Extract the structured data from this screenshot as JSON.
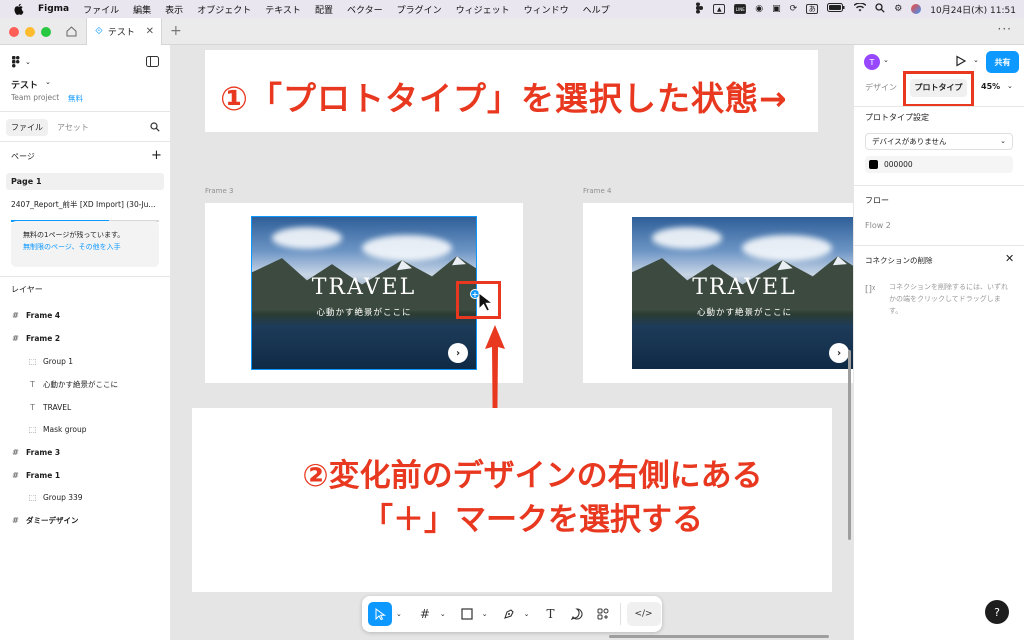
{
  "menubar": {
    "app": "Figma",
    "items": [
      "ファイル",
      "編集",
      "表示",
      "オブジェクト",
      "テキスト",
      "配置",
      "ベクター",
      "プラグイン",
      "ウィジェット",
      "ウィンドウ",
      "ヘルプ"
    ],
    "input_mode": "あ",
    "clock": "10月24日(木)  11:51"
  },
  "window": {
    "tab_title": "テスト",
    "more": "···"
  },
  "left_panel": {
    "file_name": "テスト",
    "team": "Team project",
    "plan": "無料",
    "tabs": [
      "ファイル",
      "アセット"
    ],
    "pages_header": "ページ",
    "pages": [
      "Page 1",
      "2407_Report_前半  [XD Import] (30-Ju..."
    ],
    "upgrade_line1": "無料の1ページが残っています。",
    "upgrade_link": "無制限のページ、その他を入手",
    "upgrade_progress": 0.66,
    "layers_header": "レイヤー",
    "layers": [
      {
        "name": "Frame 4",
        "bold": true,
        "icon": "frame-icon"
      },
      {
        "name": "Frame 2",
        "bold": true,
        "icon": "frame-icon"
      },
      {
        "name": "Group 1",
        "bold": false,
        "icon": "group-icon"
      },
      {
        "name": "心動かす絶景がここに",
        "bold": false,
        "icon": "text-icon"
      },
      {
        "name": "TRAVEL",
        "bold": false,
        "icon": "text-icon"
      },
      {
        "name": "Mask group",
        "bold": false,
        "icon": "group-icon"
      },
      {
        "name": "Frame 3",
        "bold": true,
        "icon": "frame-icon"
      },
      {
        "name": "Frame 1",
        "bold": true,
        "icon": "frame-icon"
      },
      {
        "name": "Group 339",
        "bold": false,
        "icon": "group-icon"
      },
      {
        "name": "ダミーデザイン",
        "bold": true,
        "icon": "frame-icon"
      }
    ]
  },
  "canvas": {
    "frame3_label": "Frame 3",
    "frame4_label": "Frame 4",
    "card_title": "TRAVEL",
    "card_subtitle": "心動かす絶景がここに",
    "callout1": "①「プロトタイプ」を選択した状態→",
    "callout2_line1": "②変化前のデザインの右側にある",
    "callout2_line2": "「＋」マークを選択する",
    "accent_color": "#e8381f",
    "selection_color": "#0d99ff"
  },
  "toolbar": {
    "tools": [
      "move-tool",
      "frame-tool",
      "shape-tool",
      "pen-tool",
      "text-tool",
      "comment-tool",
      "actions-tool",
      "dev-mode-toggle"
    ]
  },
  "right_panel": {
    "avatar_initial": "T",
    "share_label": "共有",
    "tab_design": "デザイン",
    "tab_prototype": "プロトタイプ",
    "zoom": "45%",
    "prototype_settings": "プロトタイプ設定",
    "device_select": "デバイスがありません",
    "bg_color": "000000",
    "flow_header": "フロー",
    "flow_item": "Flow 2",
    "connection_header": "コネクションの削除",
    "connection_help": "コネクションを削除するには、いずれかの端をクリックしてドラッグします。",
    "help": "?"
  }
}
